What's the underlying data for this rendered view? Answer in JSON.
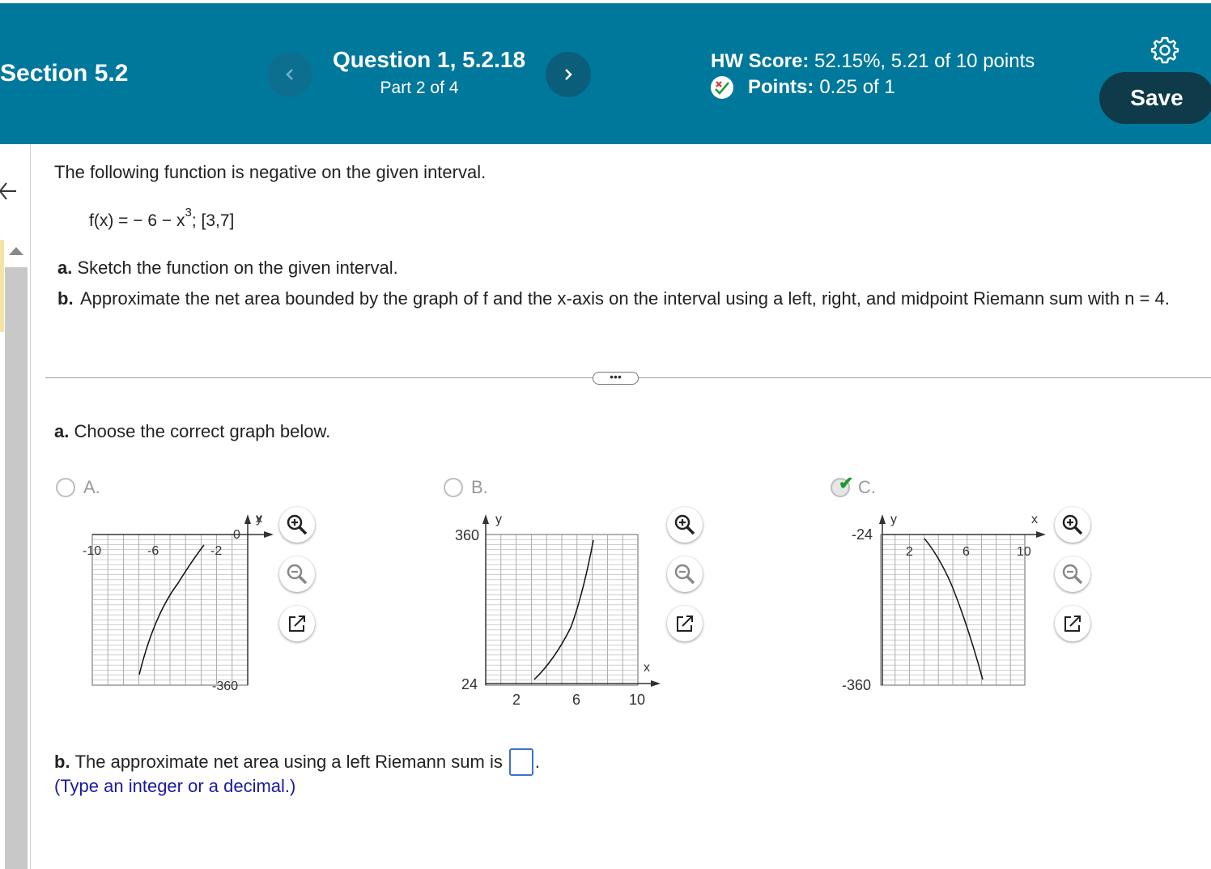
{
  "header": {
    "section_title": "Section 5.2",
    "prev_icon": "chevron-left-icon",
    "next_icon": "chevron-right-icon",
    "question_title": "Question 1, 5.2.18",
    "question_part": "Part 2 of 4",
    "hw_score_label": "HW Score:",
    "hw_score_value": "52.15%, 5.21 of 10 points",
    "points_label": "Points:",
    "points_value": "0.25 of 1",
    "settings_icon": "gear-icon",
    "save_label": "Save",
    "accent": "#00789c"
  },
  "question": {
    "intro": "The following function is negative on the given interval.",
    "function_lhs": "f(x) = − 6 − x",
    "function_exp": "3",
    "function_rhs": "; [3,7]",
    "part_a_label": "a.",
    "part_a_text": "Sketch the function on the given interval.",
    "part_b_label": "b.",
    "part_b_text": "Approximate the net area bounded by the graph of f and the x-axis on the interval using a left, right, and midpoint Riemann sum with n = 4."
  },
  "divider_label": "•••",
  "answer_a": {
    "label": "a.",
    "prompt": "Choose the correct graph below.",
    "options": [
      {
        "letter": "A.",
        "selected": false
      },
      {
        "letter": "B.",
        "selected": false
      },
      {
        "letter": "C.",
        "selected": true
      }
    ]
  },
  "graphs": {
    "a": {
      "x_tick_labels": [
        "-10",
        "-6",
        "-2"
      ],
      "y_tick_labels": [
        "0",
        "-360"
      ],
      "x_axis_label": "x",
      "y_axis_label": "y"
    },
    "b": {
      "x_tick_labels": [
        "2",
        "6",
        "10"
      ],
      "y_tick_labels": [
        "360",
        "24"
      ],
      "x_axis_label": "x",
      "y_axis_label": "y"
    },
    "c": {
      "x_tick_labels": [
        "2",
        "6",
        "10"
      ],
      "y_tick_labels": [
        "-24",
        "-360"
      ],
      "x_axis_label": "x",
      "y_axis_label": "y"
    },
    "tool_icons": [
      "zoom-in-icon",
      "zoom-out-icon",
      "pop-out-icon"
    ]
  },
  "answer_b": {
    "label": "b.",
    "prompt": "The approximate net area using a left Riemann sum is",
    "value": "",
    "period": ".",
    "hint": "(Type an integer or a decimal.)"
  }
}
